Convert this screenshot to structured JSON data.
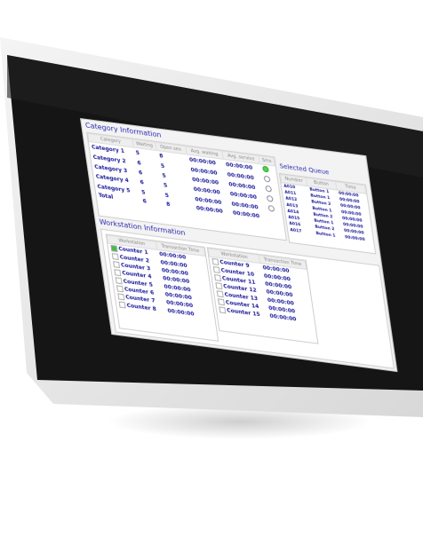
{
  "category_info": {
    "title": "Category Information",
    "columns": [
      "Category",
      "Waiting",
      "Open sev.",
      "Avg. waiting",
      "Avg. service",
      "Sms"
    ],
    "rows": [
      [
        "Category 1",
        "5",
        "8",
        "00:00:00",
        "00:00:00"
      ],
      [
        "Category 2",
        "6",
        "5",
        "00:00:00",
        "00:00:00"
      ],
      [
        "Category 3",
        "6",
        "5",
        "00:00:00",
        "00:00:00"
      ],
      [
        "Category 4",
        "6",
        "5",
        "00:00:00",
        "00:00:00"
      ],
      [
        "Category 5",
        "5",
        "5",
        "00:00:00",
        "00:00:00"
      ],
      [
        "Total",
        "6",
        "8",
        "00:00:00",
        "00:00:00"
      ]
    ],
    "selected_index": 0
  },
  "selected_queue": {
    "title": "Selected Queue",
    "columns": [
      "Number",
      "Button",
      "Time"
    ],
    "rows": [
      [
        "A010",
        "Button 1",
        "00:00:00"
      ],
      [
        "A011",
        "Button 1",
        "00:00:00"
      ],
      [
        "A012",
        "Button 2",
        "00:00:00"
      ],
      [
        "A013",
        "Button 1",
        "00:00:00"
      ],
      [
        "A014",
        "Button 2",
        "00:00:00"
      ],
      [
        "A015",
        "Button 1",
        "00:00:00"
      ],
      [
        "A016",
        "Button 2",
        "00:00:00"
      ],
      [
        "A017",
        "Button 1",
        "00:00:00"
      ]
    ]
  },
  "workstation_info": {
    "title": "Workstation Information",
    "columns": [
      "Workstation",
      "Transaction Time"
    ],
    "left": [
      [
        "Counter 1",
        "00:00:00"
      ],
      [
        "Counter 2",
        "00:00:00"
      ],
      [
        "Counter 3",
        "00:00:00"
      ],
      [
        "Counter 4",
        "00:00:00"
      ],
      [
        "Counter 5",
        "00:00:00"
      ],
      [
        "Counter 6",
        "00:00:00"
      ],
      [
        "Counter 7",
        "00:00:00"
      ],
      [
        "Counter 8",
        "00:00:00"
      ]
    ],
    "right": [
      [
        "Counter 9",
        "00:00:00"
      ],
      [
        "Counter 10",
        "00:00:00"
      ],
      [
        "Counter 11",
        "00:00:00"
      ],
      [
        "Counter 12",
        "00:00:00"
      ],
      [
        "Counter 13",
        "00:00:00"
      ],
      [
        "Counter 14",
        "00:00:00"
      ],
      [
        "Counter 15",
        "00:00:00"
      ]
    ],
    "active_index": 0
  },
  "colors": {
    "text": "#1a1a9a",
    "active": "#44bb44"
  }
}
